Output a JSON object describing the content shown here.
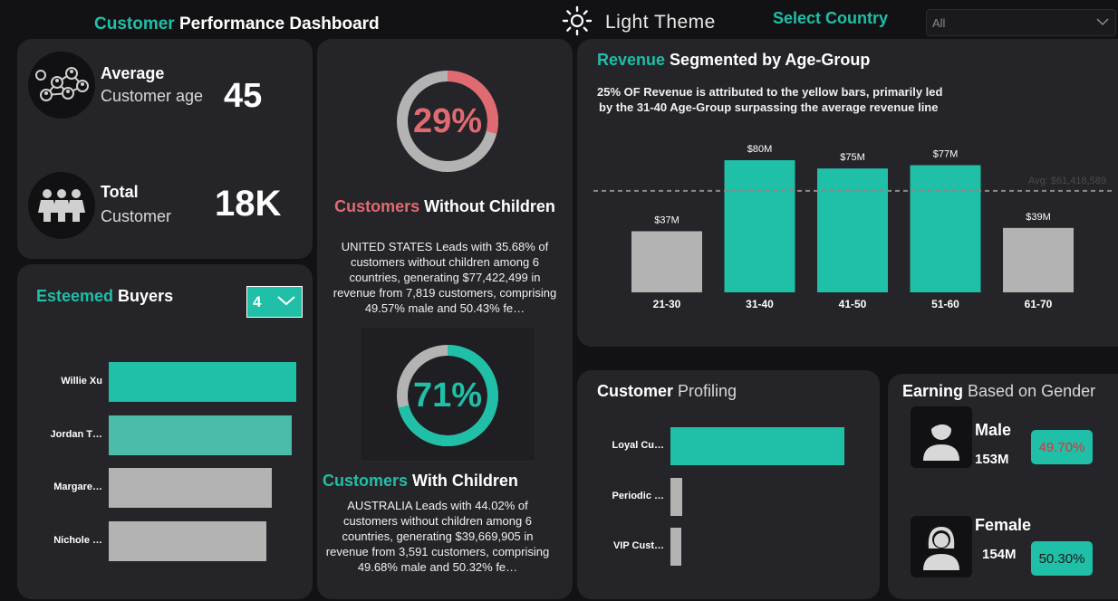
{
  "header": {
    "title_accent": "Customer",
    "title_rest": " Performance Dashboard",
    "theme_label": "Light Theme",
    "country_label": "Select Country",
    "country_value": "All"
  },
  "kpis": {
    "avg_age": {
      "label_line1": "Average",
      "label_line2": "Customer age",
      "value": "45"
    },
    "total_customers": {
      "label_line1": "Total",
      "label_line2": "Customer",
      "value": "18K"
    }
  },
  "without_children": {
    "percent_label": "29%",
    "percent": 29,
    "title_accent": "Customers",
    "title_rest": " Without Children",
    "description": "UNITED STATES Leads with 35.68% of customers without children among 6 countries, generating $77,422,499 in revenue from 7,819 customers, comprising 49.57% male and 50.43% fe…",
    "color": "#e06a72"
  },
  "with_children": {
    "percent_label": "71%",
    "percent": 71,
    "title_accent": "Customers",
    "title_rest": " With Children",
    "description": "AUSTRALIA Leads with 44.02% of customers without children among 6 countries, generating $39,669,905 in revenue from 3,591 customers, comprising 49.68% male and 50.32% fe…",
    "color": "#1fbfa8"
  },
  "esteemed_buyers": {
    "title_accent": "Esteemed",
    "title_rest": " Buyers",
    "top_n": "4",
    "items": [
      {
        "label": "Willie Xu",
        "value": 1.0,
        "color": "#1fbfa8"
      },
      {
        "label": "Jordan T…",
        "value": 0.975,
        "color": "#4bbcaa"
      },
      {
        "label": "Margare…",
        "value": 0.87,
        "color": "#b3b3b3"
      },
      {
        "label": "Nichole …",
        "value": 0.84,
        "color": "#b3b3b3"
      }
    ]
  },
  "revenue_chart": {
    "title_accent": "Revenue",
    "title_rest": " Segmented by Age-Group",
    "subtitle_line1": "25% OF Revenue is attributed to the yellow bars, primarily led",
    "subtitle_line2": "by the 31-40 Age-Group surpassing the average revenue line",
    "avg_label": "Avg: $61,418,589"
  },
  "chart_data": {
    "type": "bar",
    "title": "Revenue Segmented by Age-Group",
    "categories": [
      "21-30",
      "31-40",
      "41-50",
      "51-60",
      "61-70"
    ],
    "values": [
      37,
      80,
      75,
      77,
      39
    ],
    "value_labels": [
      "$37M",
      "$80M",
      "$75M",
      "$77M",
      "$39M"
    ],
    "colors": [
      "#b3b3b3",
      "#1fbfa8",
      "#1fbfa8",
      "#1fbfa8",
      "#b3b3b3"
    ],
    "average": 61.418589,
    "ylim": [
      0,
      90
    ],
    "grid": false
  },
  "customer_profiling": {
    "title_bold": "Customer",
    "title_rest": " Profiling",
    "items": [
      {
        "label": "Loyal Cu…",
        "value": 1.0,
        "color": "#1fbfa8"
      },
      {
        "label": "Periodic …",
        "value": 0.07,
        "color": "#b3b3b3"
      },
      {
        "label": "VIP Cust…",
        "value": 0.05,
        "color": "#b3b3b3"
      }
    ]
  },
  "gender_earning": {
    "title_bold": "Earning",
    "title_rest": " Based on Gender",
    "male": {
      "label": "Male",
      "value": "153M",
      "percent": "49.70%",
      "percent_color": "#e0303a"
    },
    "female": {
      "label": "Female",
      "value": "154M",
      "percent": "50.30%",
      "percent_color": "#1a1a1a"
    }
  }
}
